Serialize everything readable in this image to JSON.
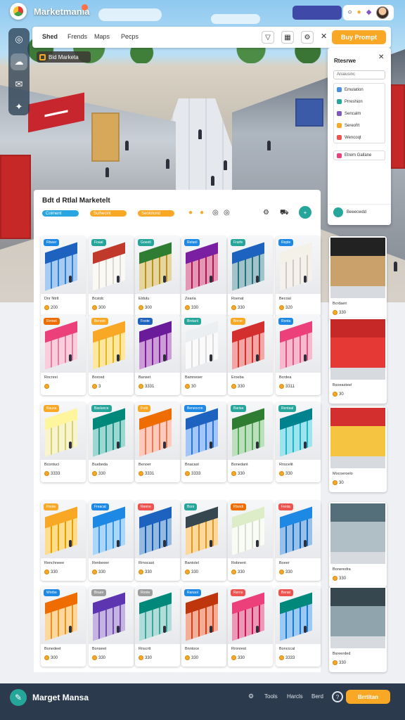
{
  "app": {
    "title": "Marketmania"
  },
  "top_right": {
    "pill_label": ""
  },
  "tabs": [
    {
      "label": "Shed"
    },
    {
      "label": "Frends"
    },
    {
      "label": "Maps"
    },
    {
      "label": "Pecps"
    }
  ],
  "toolbar": {
    "cta_label": "Buy Prompt"
  },
  "location_chip": {
    "label": "Bid Marketa"
  },
  "side_panel": {
    "title": "Rtesrwe",
    "search_placeholder": "Anaiusinc",
    "items": [
      {
        "label": "Emulation",
        "color": "#4a90e2"
      },
      {
        "label": "Prreshion",
        "color": "#26a69a"
      },
      {
        "label": "Sencalm",
        "color": "#7e57c2"
      },
      {
        "label": "Sereofrt",
        "color": "#f9a825"
      },
      {
        "label": "Wencoqt",
        "color": "#ef5350"
      }
    ],
    "field_label": "Etrem Gallane",
    "footer_label": "Beeecwdd"
  },
  "catalog": {
    "title": "Bdt d Rtlal Marketelt",
    "filters": [
      {
        "label": "Coiment",
        "color": "#29a6e0"
      },
      {
        "label": "Sulhecint",
        "color": "#f9a825"
      },
      {
        "label": "Seolotond",
        "color": "#f9a825"
      }
    ],
    "items": [
      {
        "tag": "Rbwer",
        "tag_color": "#1e88e5",
        "name": "Dnr Ntrlt",
        "price": "200",
        "top": "#1e62c0",
        "face": "#3a8ee6"
      },
      {
        "tag": "Foaal",
        "tag_color": "#26a69a",
        "name": "Bcstdc",
        "price": "300",
        "top": "#c0392b",
        "face": "#f4f1e8"
      },
      {
        "tag": "Goeetl",
        "tag_color": "#26a69a",
        "name": "Eldulu",
        "price": "300",
        "top": "#2e7d32",
        "face": "#c9a227"
      },
      {
        "tag": "Retanl",
        "tag_color": "#1e88e5",
        "name": "Zearia",
        "price": "330",
        "top": "#7b1fa2",
        "face": "#c2185b"
      },
      {
        "tag": "Frarfe",
        "tag_color": "#26a69a",
        "name": "Rsenat",
        "price": "330",
        "top": "#1e62c0",
        "face": "#2e7d8a"
      },
      {
        "tag": "Repte",
        "tag_color": "#1e88e5",
        "name": "Becoal",
        "price": "320",
        "top": "#f4f1e8",
        "face": "#e8e1d6"
      },
      {
        "tag": "Rmnet",
        "tag_color": "#ef6c00",
        "name": "Rocnrei",
        "price": "",
        "top": "#ec407a",
        "face": "#f48fb1"
      },
      {
        "tag": "Benoni",
        "tag_color": "#f9a825",
        "name": "Borosd",
        "price": "3",
        "top": "#f9a825",
        "face": "#ffca28"
      },
      {
        "tag": "Foote",
        "tag_color": "#1e62c0",
        "name": "Banset",
        "price": "3331",
        "top": "#6a1b9a",
        "face": "#8e24aa"
      },
      {
        "tag": "Bretanl",
        "tag_color": "#26a69a",
        "name": "Bamneser",
        "price": "30",
        "top": "#eceff1",
        "face": "#f5f5f5"
      },
      {
        "tag": "Bncer",
        "tag_color": "#f9a825",
        "name": "Eroeba",
        "price": "330",
        "top": "#d32f2f",
        "face": "#e53935"
      },
      {
        "tag": "Ronta",
        "tag_color": "#1e88e5",
        "name": "Bcrdea",
        "price": "3311",
        "top": "#ec407a",
        "face": "#f06292"
      },
      {
        "tag": "Bauna",
        "tag_color": "#f9a825",
        "name": "Bcontuci",
        "price": "3333",
        "top": "#fff59d",
        "face": "#f0e68c"
      },
      {
        "tag": "Baslunce",
        "tag_color": "#26a69a",
        "name": "Buebeda",
        "price": "330",
        "top": "#00897b",
        "face": "#26a69a"
      },
      {
        "tag": "Freb",
        "tag_color": "#f9a825",
        "name": "Benoer",
        "price": "3331",
        "top": "#ef6c00",
        "face": "#ff8a65"
      },
      {
        "tag": "Beneocnn",
        "tag_color": "#1e88e5",
        "name": "Bnacast",
        "price": "3333",
        "top": "#1e62c0",
        "face": "#2f80ed"
      },
      {
        "tag": "Barisa",
        "tag_color": "#26a69a",
        "name": "Bonedant",
        "price": "330",
        "top": "#2e7d32",
        "face": "#66bb6a"
      },
      {
        "tag": "Rentaal",
        "tag_color": "#26a69a",
        "name": "Rnscelit",
        "price": "330",
        "top": "#00838f",
        "face": "#26c6da"
      },
      {
        "tag": "Rnnte",
        "tag_color": "#f9a825",
        "name": "Renchneee",
        "price": "330",
        "top": "#f9a825",
        "face": "#ffb300"
      },
      {
        "tag": "Freacal",
        "tag_color": "#1e88e5",
        "name": "Renbeeer",
        "price": "330",
        "top": "#1e88e5",
        "face": "#42a5f5"
      },
      {
        "tag": "Renne",
        "tag_color": "#ef5350",
        "name": "Rrnocast",
        "price": "330",
        "top": "#1e62c0",
        "face": "#1565c0"
      },
      {
        "tag": "Boni",
        "tag_color": "#26a69a",
        "name": "Bantolel",
        "price": "330",
        "top": "#37474f",
        "face": "#f9a825"
      },
      {
        "tag": "Rtsndi",
        "tag_color": "#ef6c00",
        "name": "Robnent",
        "price": "330",
        "top": "#dcedc8",
        "face": "#f1f8e9"
      },
      {
        "tag": "Fenta",
        "tag_color": "#ef5350",
        "name": "Boeer",
        "price": "330",
        "top": "#1e88e5",
        "face": "#1976d2"
      },
      {
        "tag": "Wnrbe",
        "tag_color": "#1e88e5",
        "name": "Bonedeet",
        "price": "300",
        "top": "#ef6c00",
        "face": "#ffa726"
      },
      {
        "tag": "Bnare",
        "tag_color": "#9e9e9e",
        "name": "Bonseet",
        "price": "330",
        "top": "#5e35b1",
        "face": "#7e57c2"
      },
      {
        "tag": "Rnnte",
        "tag_color": "#9e9e9e",
        "name": "Rnscrtt",
        "price": "330",
        "top": "#00897b",
        "face": "#4db6ac"
      },
      {
        "tag": "Ranaol",
        "tag_color": "#1e88e5",
        "name": "Bnntoce",
        "price": "330",
        "top": "#bf360c",
        "face": "#e64a19"
      },
      {
        "tag": "Rerns",
        "tag_color": "#ef5350",
        "name": "Rronrest",
        "price": "330",
        "top": "#ec407a",
        "face": "#d81b60"
      },
      {
        "tag": "Benat",
        "tag_color": "#ef5350",
        "name": "Boncccal",
        "price": "3333",
        "top": "#00897b",
        "face": "#1e88e5"
      }
    ],
    "featured": [
      {
        "name": "Bcrdaeri",
        "price": "330",
        "top": "#222",
        "face": "#caa16a"
      },
      {
        "name": "Bsoeasteel",
        "price": "30",
        "top": "#c62828",
        "face": "#e53935"
      },
      {
        "name": "Mocoeroelo",
        "price": "30",
        "top": "#d32f2f",
        "face": "#f5c542"
      },
      {
        "name": "Boneredra",
        "price": "330",
        "top": "#546e7a",
        "face": "#b0bec5"
      },
      {
        "name": "Bsreerded",
        "price": "330",
        "top": "#37474f",
        "face": "#90a4ae"
      }
    ]
  },
  "bottom_bar": {
    "title": "Marget Mansa",
    "links": [
      "Tools",
      "Harcls",
      "Berd"
    ],
    "cta_label": "Brrtitan"
  }
}
